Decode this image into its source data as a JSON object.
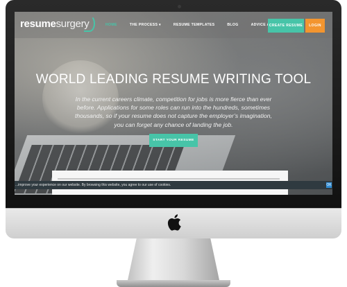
{
  "nav": {
    "logo_part1": "resume",
    "logo_part2": "surgery",
    "items": [
      {
        "label": "HOME"
      },
      {
        "label": "THE PROCESS ▾"
      },
      {
        "label": "RESUME TEMPLATES"
      },
      {
        "label": "BLOG"
      },
      {
        "label": "ADVICE ARTICLES ▾"
      }
    ],
    "resume_button": "CREATE RESUME",
    "login_button": "LOGIN"
  },
  "hero": {
    "title": "WORLD LEADING RESUME WRITING TOOL",
    "text": "In the current careers climate, competition for jobs is more fierce than ever before. Applications for some roles can run into the hundreds, sometimes thousands, so if your resume does not capture the employer’s imagination, you can forget any chance of landing the job.",
    "cta": "START YOUR RESUME"
  },
  "cookie": {
    "text": "...improve your experience on our website. By browsing this website, you agree to our use of cookies.",
    "button": "OK"
  },
  "colors": {
    "accent": "#47c4a8",
    "login": "#f3952f",
    "cookie_bar": "#2f3a40"
  },
  "icons": {
    "logo": "resume-surgery-logo-arc",
    "computer_brand": "apple-icon"
  }
}
